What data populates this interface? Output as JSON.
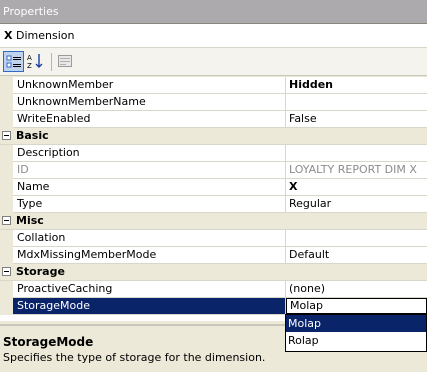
{
  "window": {
    "title": "Properties"
  },
  "object": {
    "icon_glyph": "X",
    "name": "Dimension"
  },
  "toolbar": {
    "items": [
      "categorized-button",
      "alphabetical-button",
      "property-pages-button"
    ]
  },
  "grid": {
    "rows": [
      {
        "kind": "prop",
        "name": "UnknownMember",
        "value": "Hidden",
        "style": "bold"
      },
      {
        "kind": "prop",
        "name": "UnknownMemberName",
        "value": ""
      },
      {
        "kind": "prop",
        "name": "WriteEnabled",
        "value": "False"
      },
      {
        "kind": "cat",
        "name": "Basic"
      },
      {
        "kind": "prop",
        "name": "Description",
        "value": ""
      },
      {
        "kind": "prop",
        "name": "ID",
        "value": "LOYALTY REPORT DIM X",
        "style": "gray"
      },
      {
        "kind": "prop",
        "name": "Name",
        "value": "X",
        "style": "bold"
      },
      {
        "kind": "prop",
        "name": "Type",
        "value": "Regular"
      },
      {
        "kind": "cat",
        "name": "Misc"
      },
      {
        "kind": "prop",
        "name": "Collation",
        "value": ""
      },
      {
        "kind": "prop",
        "name": "MdxMissingMemberMode",
        "value": "Default"
      },
      {
        "kind": "cat",
        "name": "Storage"
      },
      {
        "kind": "prop",
        "name": "ProactiveCaching",
        "value": "(none)"
      },
      {
        "kind": "prop",
        "name": "StorageMode",
        "value": "Molap",
        "selected": true
      }
    ]
  },
  "dropdown": {
    "options": [
      "Molap",
      "Rolap"
    ],
    "highlighted": "Molap"
  },
  "description": {
    "title": "StorageMode",
    "text": "Specifies the type of storage for the dimension."
  },
  "colors": {
    "selection": "#0a246a",
    "chrome": "#ece9d8",
    "titlebar": "#adaaad"
  }
}
